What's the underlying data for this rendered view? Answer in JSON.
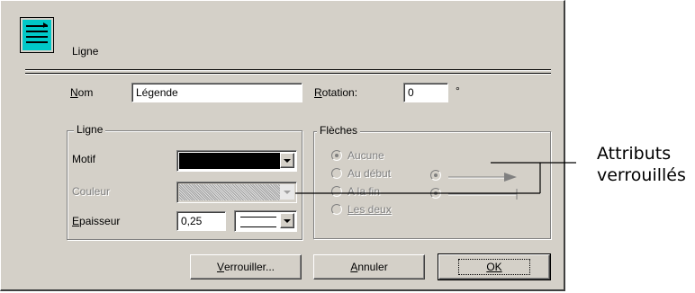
{
  "header": {
    "title": "Ligne"
  },
  "name_field": {
    "label": "Nom",
    "value": "Légende"
  },
  "rotation_field": {
    "label": "Rotation:",
    "value": "0",
    "unit": "°"
  },
  "ligne_group": {
    "title": "Ligne",
    "motif_label": "Motif",
    "couleur_label": "Couleur",
    "epaisseur_label": "Epaisseur",
    "epaisseur_value": "0,25"
  },
  "fleches_group": {
    "title": "Flèches",
    "options": [
      "Aucune",
      "Au début",
      "A la fin",
      "Les deux"
    ]
  },
  "buttons": {
    "lock": "Verrouiller...",
    "cancel": "Annuler",
    "ok": "OK"
  },
  "callout": {
    "line1": "Attributs",
    "line2": "verrouillés"
  },
  "colors": {
    "dialog_bg": "#d4d0c8",
    "icon_bg": "#00c8c8",
    "motif_swatch": "#000000"
  }
}
